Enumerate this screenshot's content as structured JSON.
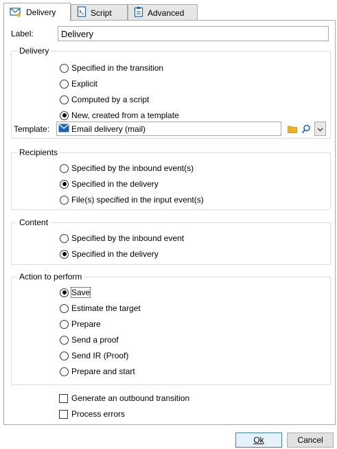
{
  "tabs": [
    {
      "label": "Delivery",
      "icon": "envelope-star-icon",
      "active": true
    },
    {
      "label": "Script",
      "icon": "script-icon",
      "active": false
    },
    {
      "label": "Advanced",
      "icon": "clipboard-icon",
      "active": false
    }
  ],
  "label_field": {
    "label": "Label:",
    "value": "Delivery"
  },
  "delivery": {
    "title": "Delivery",
    "options": [
      "Specified in the transition",
      "Explicit",
      "Computed by a script",
      "New, created from a template"
    ],
    "selected": 3,
    "template": {
      "label": "Template:",
      "value": "Email delivery (mail)"
    }
  },
  "recipients": {
    "title": "Recipients",
    "options": [
      "Specified by the inbound event(s)",
      "Specified in the delivery",
      "File(s) specified in the input event(s)"
    ],
    "selected": 1
  },
  "content": {
    "title": "Content",
    "options": [
      "Specified by the inbound event",
      "Specified in the delivery"
    ],
    "selected": 1
  },
  "action": {
    "title": "Action to perform",
    "options": [
      "Save",
      "Estimate the target",
      "Prepare",
      "Send a proof",
      "Send IR (Proof)",
      "Prepare and start"
    ],
    "selected": 0
  },
  "checkboxes": {
    "generate": "Generate an outbound transition",
    "errors": "Process errors"
  },
  "buttons": {
    "ok": "Ok",
    "cancel": "Cancel"
  },
  "colors": {
    "border": "#a9a9a9",
    "group_border": "#dcdcdc",
    "default_button": "#3c7fb1"
  }
}
